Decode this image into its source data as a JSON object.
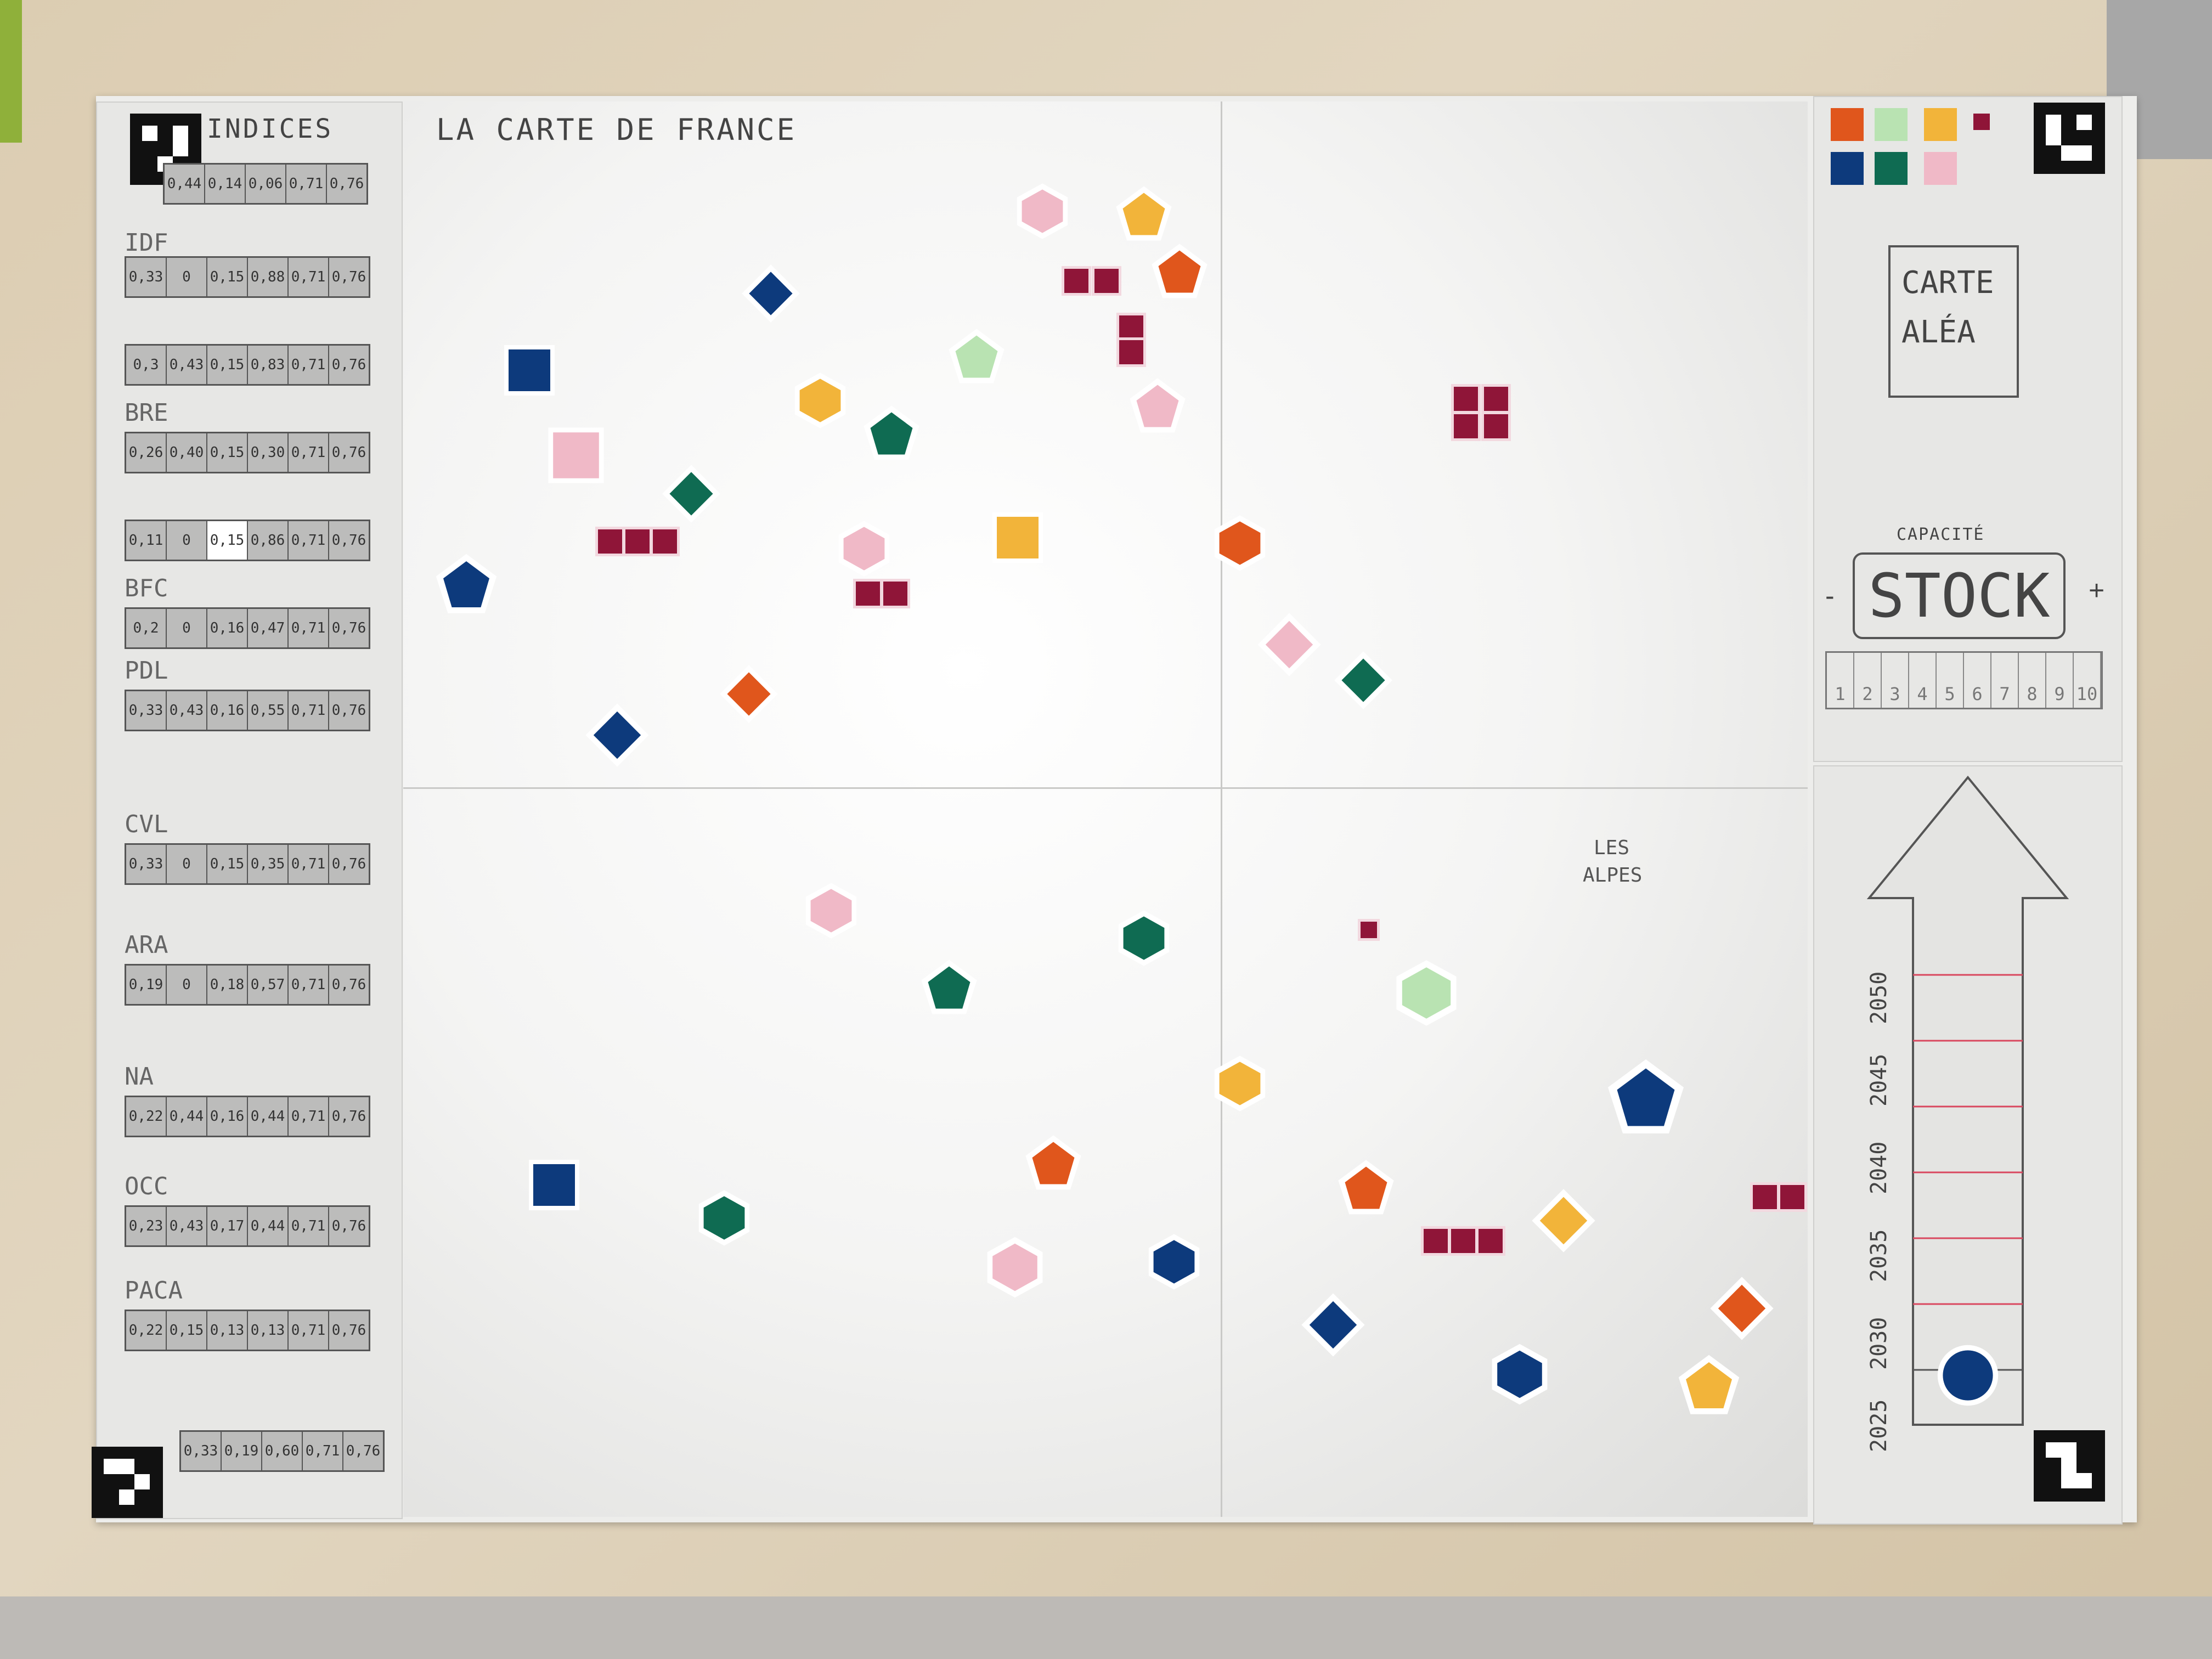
{
  "board": {
    "title": "LA CARTE DE FRANCE",
    "indices_heading": "INDICES",
    "random_card_line1": "CARTE",
    "random_card_line2": "ALÉA",
    "capacity_label": "CAPACITÉ",
    "stock_label": "STOCK",
    "stock_minus": "-",
    "stock_plus": "+",
    "alps_label_1": "LES",
    "alps_label_2": "ALPES",
    "scale_numbers": [
      "1",
      "2",
      "3",
      "4",
      "5",
      "6",
      "7",
      "8",
      "9",
      "10"
    ],
    "years": [
      "2025",
      "2030",
      "2035",
      "2040",
      "2045",
      "2050"
    ],
    "progress_current_year": "2030"
  },
  "regions": [
    {
      "label": "",
      "values": [
        "0,44",
        "0,14",
        "0,06",
        "0,71",
        "0,76"
      ]
    },
    {
      "label": "IDF",
      "values": [
        "0,33",
        "0",
        "0,15",
        "0,88",
        "0,71",
        "0,76"
      ]
    },
    {
      "label": "",
      "values": [
        "0,3",
        "0,43",
        "0,15",
        "0,83",
        "0,71",
        "0,76"
      ]
    },
    {
      "label": "BRE",
      "values": [
        "0,26",
        "0,40",
        "0,15",
        "0,30",
        "0,71",
        "0,76"
      ]
    },
    {
      "label": "",
      "values": [
        "0,11",
        "0",
        "0,15",
        "0,86",
        "0,71",
        "0,76"
      ]
    },
    {
      "label": "BFC",
      "values": [
        "0,2",
        "0",
        "0,16",
        "0,47",
        "0,71",
        "0,76"
      ]
    },
    {
      "label": "PDL",
      "values": [
        "0,33",
        "0,43",
        "0,16",
        "0,55",
        "0,71",
        "0,76"
      ]
    },
    {
      "label": "CVL",
      "values": [
        "0,33",
        "0",
        "0,15",
        "0,35",
        "0,71",
        "0,76"
      ]
    },
    {
      "label": "ARA",
      "values": [
        "0,19",
        "0",
        "0,18",
        "0,57",
        "0,71",
        "0,76"
      ]
    },
    {
      "label": "NA",
      "values": [
        "0,22",
        "0,44",
        "0,16",
        "0,44",
        "0,71",
        "0,76"
      ]
    },
    {
      "label": "OCC",
      "values": [
        "0,23",
        "0,43",
        "0,17",
        "0,44",
        "0,71",
        "0,76"
      ]
    },
    {
      "label": "PACA",
      "values": [
        "0,22",
        "0,15",
        "0,13",
        "0,13",
        "0,71",
        "0,76"
      ]
    },
    {
      "label": "",
      "values": [
        "0,33",
        "0,19",
        "0,60",
        "0,71",
        "0,76"
      ]
    }
  ],
  "colors": {
    "orange": "#e0561c",
    "light_green": "#b9e3b2",
    "yellow": "#f2b43a",
    "dark_red": "#8f1538",
    "blue": "#0d3a7c",
    "teal": "#0f6b52",
    "pink": "#f0b9c7"
  },
  "icons": {
    "marker": "aruco-marker-icon",
    "wind": "wind-turbine-icon",
    "nuclear": "nuclear-icon"
  }
}
